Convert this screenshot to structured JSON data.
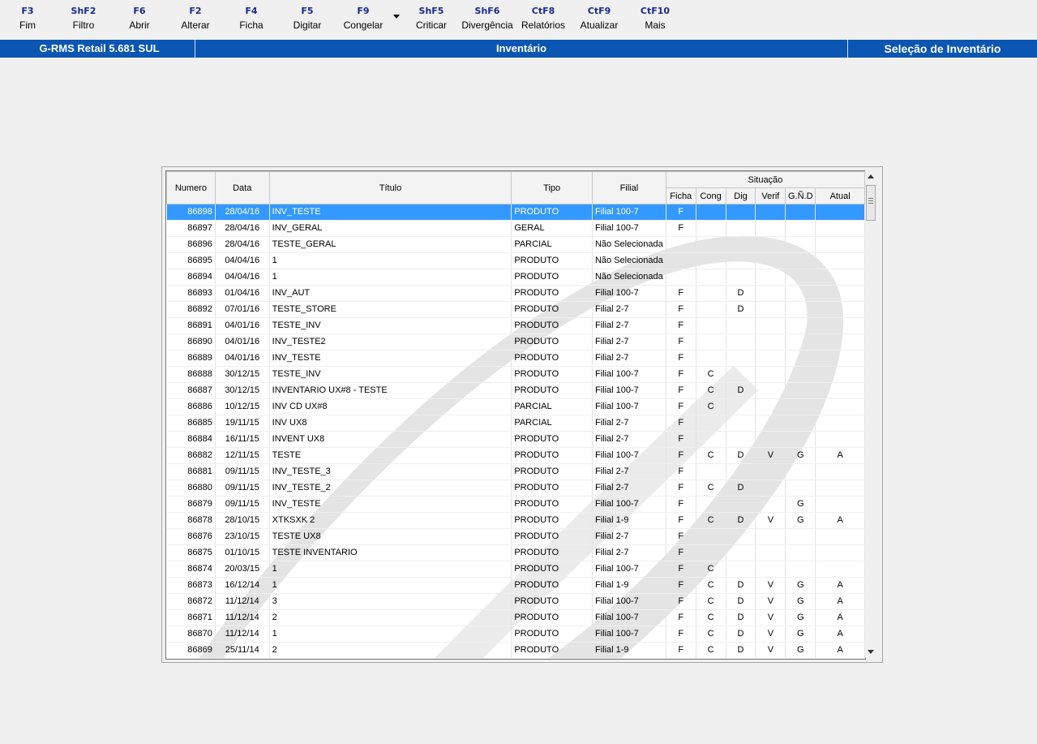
{
  "toolbar": [
    {
      "key": "F3",
      "label": "Fim"
    },
    {
      "key": "ShF2",
      "label": "Filtro"
    },
    {
      "key": "F6",
      "label": "Abrir"
    },
    {
      "key": "F2",
      "label": "Alterar"
    },
    {
      "key": "F4",
      "label": "Ficha"
    },
    {
      "key": "F5",
      "label": "Digitar"
    },
    {
      "key": "F9",
      "label": "Congelar"
    },
    {
      "key": "ShF5",
      "label": "Criticar"
    },
    {
      "key": "ShF6",
      "label": "Divergência"
    },
    {
      "key": "CtF8",
      "label": "Relatórios"
    },
    {
      "key": "CtF9",
      "label": "Atualizar"
    },
    {
      "key": "CtF10",
      "label": "Mais"
    }
  ],
  "titlebar": {
    "app": "G-RMS Retail 5.681 SUL",
    "module": "Inventário",
    "screen": "Seleção de Inventário"
  },
  "table": {
    "headers": {
      "numero": "Numero",
      "data": "Data",
      "titulo": "Título",
      "tipo": "Tipo",
      "filial": "Filial",
      "situacao": "Situação",
      "ficha": "Ficha",
      "cong": "Cong",
      "dig": "Dig",
      "verif": "Verif",
      "gnd": "G.Ñ.D",
      "atual": "Atual"
    },
    "rows": [
      [
        "86898",
        "28/04/16",
        "INV_TESTE",
        "PRODUTO",
        "Filial 100-7",
        "F",
        "",
        "",
        "",
        "",
        ""
      ],
      [
        "86897",
        "28/04/16",
        "INV_GERAL",
        "GERAL",
        "Filial 100-7",
        "F",
        "",
        "",
        "",
        "",
        ""
      ],
      [
        "86896",
        "28/04/16",
        "TESTE_GERAL",
        "PARCIAL",
        "Não Selecionada",
        "",
        "",
        "",
        "",
        "",
        ""
      ],
      [
        "86895",
        "04/04/16",
        "1",
        "PRODUTO",
        "Não Selecionada",
        "",
        "",
        "",
        "",
        "",
        ""
      ],
      [
        "86894",
        "04/04/16",
        "1",
        "PRODUTO",
        "Não Selecionada",
        "",
        "",
        "",
        "",
        "",
        ""
      ],
      [
        "86893",
        "01/04/16",
        "INV_AUT",
        "PRODUTO",
        "Filial 100-7",
        "F",
        "",
        "D",
        "",
        "",
        ""
      ],
      [
        "86892",
        "07/01/16",
        "TESTE_STORE",
        "PRODUTO",
        "Filial 2-7",
        "F",
        "",
        "D",
        "",
        "",
        ""
      ],
      [
        "86891",
        "04/01/16",
        "TESTE_INV",
        "PRODUTO",
        "Filial 2-7",
        "F",
        "",
        "",
        "",
        "",
        ""
      ],
      [
        "86890",
        "04/01/16",
        "INV_TESTE2",
        "PRODUTO",
        "Filial 2-7",
        "F",
        "",
        "",
        "",
        "",
        ""
      ],
      [
        "86889",
        "04/01/16",
        "INV_TESTE",
        "PRODUTO",
        "Filial 2-7",
        "F",
        "",
        "",
        "",
        "",
        ""
      ],
      [
        "86888",
        "30/12/15",
        "TESTE_INV",
        "PRODUTO",
        "Filial 100-7",
        "F",
        "C",
        "",
        "",
        "",
        ""
      ],
      [
        "86887",
        "30/12/15",
        "INVENTARIO UX#8 - TESTE",
        "PRODUTO",
        "Filial 100-7",
        "F",
        "C",
        "D",
        "",
        "",
        ""
      ],
      [
        "86886",
        "10/12/15",
        "INV CD UX#8",
        "PARCIAL",
        "Filial 100-7",
        "F",
        "C",
        "",
        "",
        "",
        ""
      ],
      [
        "86885",
        "19/11/15",
        "INV UX8",
        "PARCIAL",
        "Filial 2-7",
        "F",
        "",
        "",
        "",
        "",
        ""
      ],
      [
        "86884",
        "16/11/15",
        "INVENT UX8",
        "PRODUTO",
        "Filial 2-7",
        "F",
        "",
        "",
        "",
        "",
        ""
      ],
      [
        "86882",
        "12/11/15",
        "TESTE",
        "PRODUTO",
        "Filial 100-7",
        "F",
        "C",
        "D",
        "V",
        "G",
        "A"
      ],
      [
        "86881",
        "09/11/15",
        "INV_TESTE_3",
        "PRODUTO",
        "Filial 2-7",
        "F",
        "",
        "",
        "",
        "",
        ""
      ],
      [
        "86880",
        "09/11/15",
        "INV_TESTE_2",
        "PRODUTO",
        "Filial 2-7",
        "F",
        "C",
        "D",
        "",
        "",
        ""
      ],
      [
        "86879",
        "09/11/15",
        "INV_TESTE",
        "PRODUTO",
        "Filial 100-7",
        "F",
        "",
        "",
        "",
        "G",
        ""
      ],
      [
        "86878",
        "28/10/15",
        "XTKSXK 2",
        "PRODUTO",
        "Filial 1-9",
        "F",
        "C",
        "D",
        "V",
        "G",
        "A"
      ],
      [
        "86876",
        "23/10/15",
        "TESTE UX8",
        "PRODUTO",
        "Filial 2-7",
        "F",
        "",
        "",
        "",
        "",
        ""
      ],
      [
        "86875",
        "01/10/15",
        "TESTE INVENTARIO",
        "PRODUTO",
        "Filial 2-7",
        "F",
        "",
        "",
        "",
        "",
        ""
      ],
      [
        "86874",
        "20/03/15",
        "1",
        "PRODUTO",
        "Filial 100-7",
        "F",
        "C",
        "",
        "",
        "",
        ""
      ],
      [
        "86873",
        "16/12/14",
        "1",
        "PRODUTO",
        "Filial 1-9",
        "F",
        "C",
        "D",
        "V",
        "G",
        "A"
      ],
      [
        "86872",
        "11/12/14",
        "3",
        "PRODUTO",
        "Filial 100-7",
        "F",
        "C",
        "D",
        "V",
        "G",
        "A"
      ],
      [
        "86871",
        "11/12/14",
        "2",
        "PRODUTO",
        "Filial 100-7",
        "F",
        "C",
        "D",
        "V",
        "G",
        "A"
      ],
      [
        "86870",
        "11/12/14",
        "1",
        "PRODUTO",
        "Filial 100-7",
        "F",
        "C",
        "D",
        "V",
        "G",
        "A"
      ],
      [
        "86869",
        "25/11/14",
        "2",
        "PRODUTO",
        "Filial 1-9",
        "F",
        "C",
        "D",
        "V",
        "G",
        "A"
      ]
    ]
  },
  "colors": {
    "titlebar": "#0a56b2",
    "selection": "#3399ff",
    "hotkey": "#1a2a8a"
  }
}
